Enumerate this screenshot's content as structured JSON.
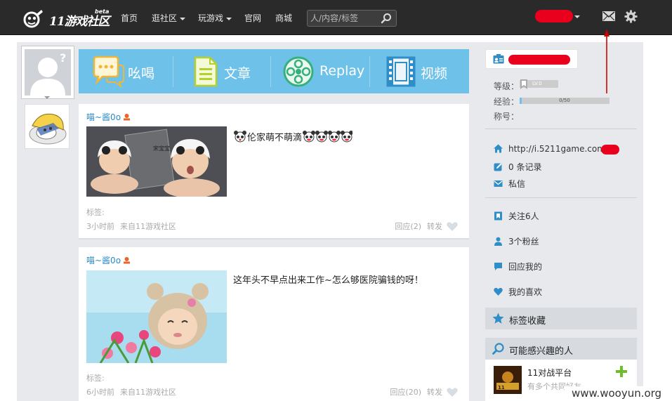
{
  "header": {
    "logo_text": "11游戏社区",
    "logo_badge": "beta",
    "nav": [
      {
        "label": "首页",
        "dropdown": false
      },
      {
        "label": "逛社区",
        "dropdown": true
      },
      {
        "label": "玩游戏",
        "dropdown": true
      },
      {
        "label": "官网",
        "dropdown": false
      },
      {
        "label": "商城",
        "dropdown": false
      }
    ],
    "search_placeholder": "人/内容/标签",
    "icons": [
      "search-icon",
      "mail-icon",
      "gear-icon"
    ]
  },
  "tabs": [
    {
      "label": "吆喝",
      "icon": "chat-bubbles-icon"
    },
    {
      "label": "文章",
      "icon": "document-icon"
    },
    {
      "label": "Replay",
      "icon": "film-reel-icon"
    },
    {
      "label": "视频",
      "icon": "film-strip-icon"
    }
  ],
  "posts": [
    {
      "author": "喵~酱0o",
      "text": "伦家萌不萌滴",
      "tags_label": "标签:",
      "time": "3小时前",
      "source": "来自11游戏社区",
      "reply": "回应(2)",
      "forward": "转发"
    },
    {
      "author": "喵~酱0o",
      "text": "这年头不早点出来工作~怎么够医院骗钱的呀！",
      "tags_label": "标签:",
      "time": "6小时前",
      "source": "来自11游戏社区",
      "reply": "回应(20)",
      "forward": "转发"
    }
  ],
  "profile": {
    "level_label": "等级：",
    "level_value": "LV.0",
    "exp_label": "经验：",
    "exp_text": "0/50",
    "exp_fraction": 0.02,
    "title_label": "称号：",
    "homepage": "http://i.5211game.com",
    "records": "0 条记录",
    "messages": "私信",
    "following": "关注6人",
    "fans": "3个粉丝",
    "replies_to_me": "回应我的",
    "my_likes": "我的喜欢"
  },
  "panels": {
    "tag_collection": "标签收藏",
    "suggested_people": "可能感兴趣的人"
  },
  "suggestion": {
    "name": "11对战平台",
    "sub": "有多个共同好友"
  },
  "watermark": "www.wooyun.org",
  "colors": {
    "topbar": "#2a2a2a",
    "tab_bar": "#6ec2ea",
    "link_blue": "#2b8bc6",
    "redaction": "#e8001c",
    "panel_bg": "#e7e9ed"
  }
}
